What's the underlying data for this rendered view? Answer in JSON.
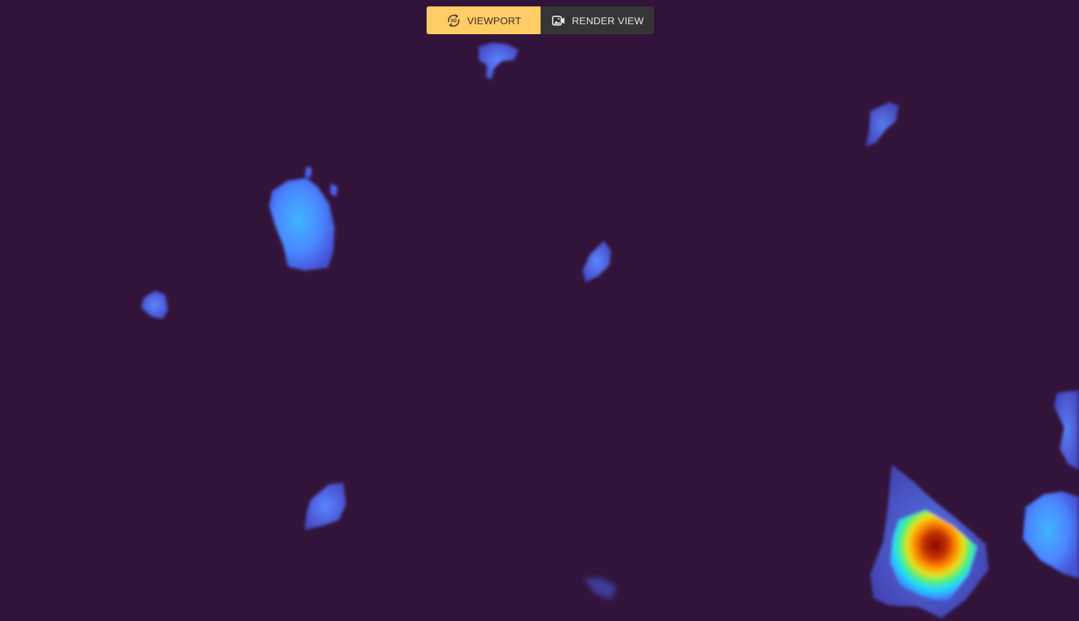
{
  "toolbar": {
    "viewport_label": "VIEWPORT",
    "viewport_icon": "rotate-3d-icon",
    "render_label": "RENDER VIEW",
    "render_icon": "video-camera-image-icon",
    "active_mode": "viewport"
  },
  "colors": {
    "background": "#32133a",
    "active_button": "#ffcc66",
    "inactive_button": "#353538",
    "heatmap_low": "#4a6cff",
    "heatmap_mid": "#3fd7ff",
    "heatmap_high": "#8a0a00"
  }
}
